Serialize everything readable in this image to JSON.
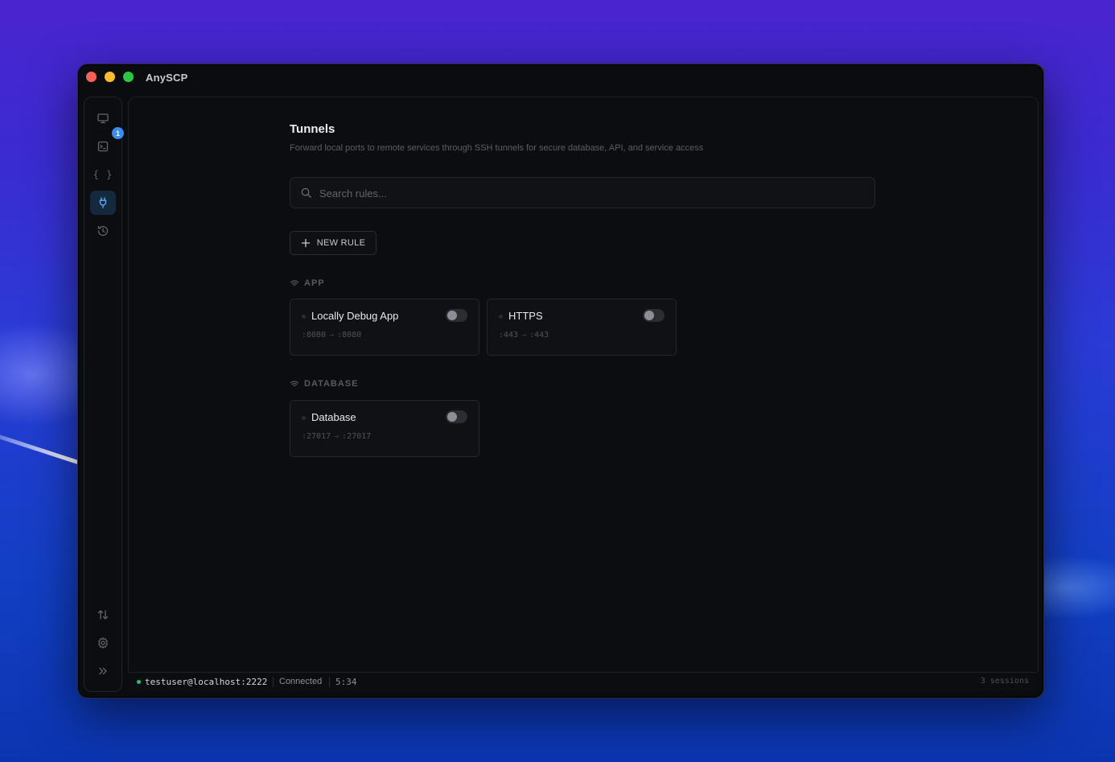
{
  "window": {
    "app_title": "AnySCP"
  },
  "sidebar": {
    "items": [
      {
        "name": "monitor-icon",
        "active": false
      },
      {
        "name": "terminal-icon",
        "active": false,
        "badge": "1"
      },
      {
        "name": "braces-icon",
        "glyph": "{ }",
        "active": false
      },
      {
        "name": "plug-icon",
        "active": true
      },
      {
        "name": "history-icon",
        "active": false
      }
    ],
    "bottom": [
      "transfer-icon",
      "gear-icon",
      "chevrons-right-icon"
    ]
  },
  "page": {
    "title": "Tunnels",
    "description": "Forward local ports to remote services through SSH tunnels for secure database, API, and service access"
  },
  "search": {
    "placeholder": "Search rules...",
    "value": ""
  },
  "new_rule_label": "NEW RULE",
  "groups": [
    {
      "label": "APP",
      "rules": [
        {
          "name": "Locally Debug App",
          "local": ":8080",
          "remote": ":8080",
          "enabled": false
        },
        {
          "name": "HTTPS",
          "local": ":443",
          "remote": ":443",
          "enabled": false
        }
      ]
    },
    {
      "label": "DATABASE",
      "rules": [
        {
          "name": "Database",
          "local": ":27017",
          "remote": ":27017",
          "enabled": false
        }
      ]
    }
  ],
  "statusbar": {
    "user": "testuser@localhost:2222",
    "state": "Connected",
    "time": "5:34",
    "sessions": "3 sessions"
  },
  "arrow_glyph": "→",
  "colors": {
    "accent": "#3b8cf0",
    "connected": "#29c26b",
    "active_bg": "#15293e"
  }
}
